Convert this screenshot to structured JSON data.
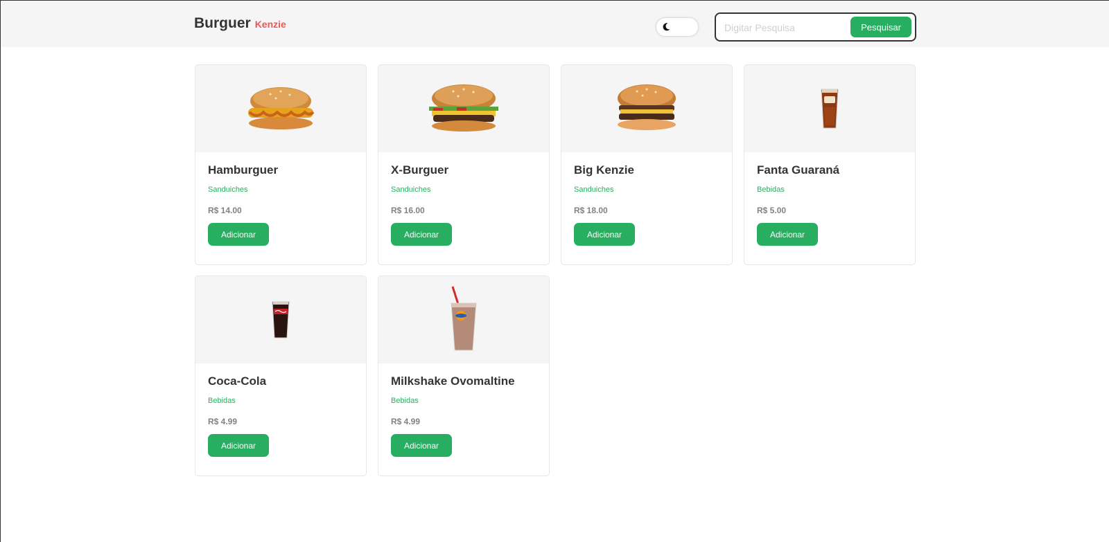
{
  "header": {
    "brand_main": "Burguer",
    "brand_sub": "Kenzie",
    "theme_toggle_icon": "moon-icon",
    "search": {
      "placeholder": "Digitar Pesquisa",
      "value": "",
      "button_label": "Pesquisar"
    }
  },
  "colors": {
    "accent": "#27ae60",
    "brand_sub": "#eb5757",
    "header_bg": "#f5f5f5"
  },
  "products": [
    {
      "name": "Hamburguer",
      "category": "Sanduiches",
      "price": "R$ 14.00",
      "button": "Adicionar",
      "image": "hamburger-image"
    },
    {
      "name": "X-Burguer",
      "category": "Sanduiches",
      "price": "R$ 16.00",
      "button": "Adicionar",
      "image": "x-burger-image"
    },
    {
      "name": "Big Kenzie",
      "category": "Sanduiches",
      "price": "R$ 18.00",
      "button": "Adicionar",
      "image": "big-kenzie-image"
    },
    {
      "name": "Fanta Guaraná",
      "category": "Bebidas",
      "price": "R$ 5.00",
      "button": "Adicionar",
      "image": "fanta-glass-image"
    },
    {
      "name": "Coca-Cola",
      "category": "Bebidas",
      "price": "R$ 4.99",
      "button": "Adicionar",
      "image": "coca-cola-glass-image"
    },
    {
      "name": "Milkshake Ovomaltine",
      "category": "Bebidas",
      "price": "R$ 4.99",
      "button": "Adicionar",
      "image": "milkshake-image"
    }
  ]
}
